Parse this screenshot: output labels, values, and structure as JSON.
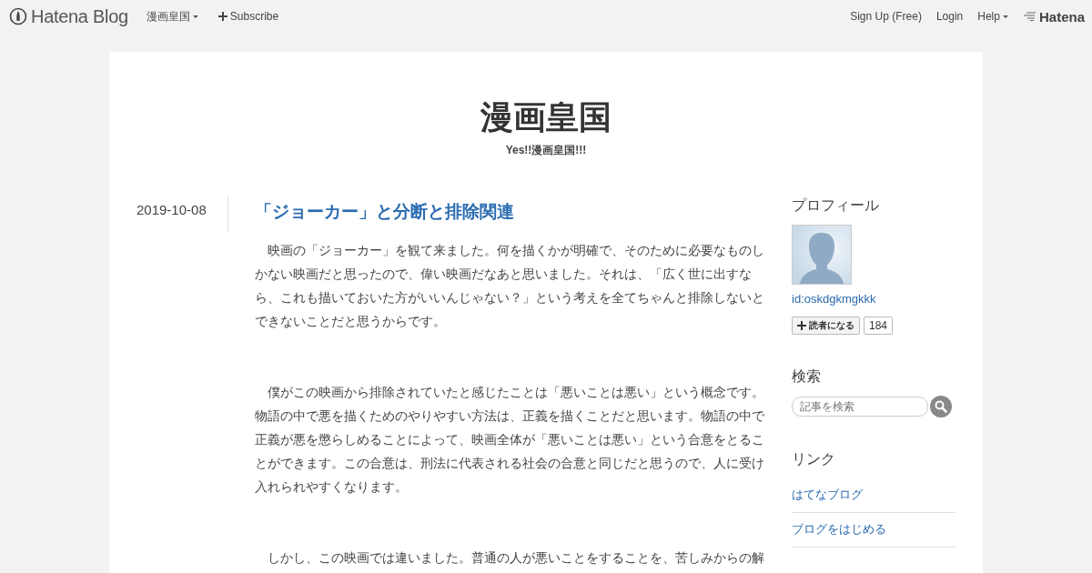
{
  "top_bar": {
    "brand": "Hatena Blog",
    "blog_menu": "漫画皇国",
    "subscribe": "Subscribe",
    "links": [
      {
        "label": "Sign Up (Free)",
        "kind": "link"
      },
      {
        "label": "Login",
        "kind": "link"
      },
      {
        "label": "Help",
        "kind": "menu"
      }
    ],
    "hatena_logo": "Hatena"
  },
  "blog": {
    "title": "漫画皇国",
    "tagline": "Yes!!漫画皇国!!!"
  },
  "entry": {
    "date": "2019-10-08",
    "title": "「ジョーカー」と分断と排除関連",
    "paragraphs": [
      "映画の「ジョーカー」を観て来ました。何を描くかが明確で、そのために必要なものしかない映画だと思ったので、偉い映画だなあと思いました。それは、「広く世に出すなら、これも描いておいた方がいいんじゃない？」という考えを全てちゃんと排除しないとできないことだと思うからです。",
      "僕がこの映画から排除されていたと感じたことは「悪いことは悪い」という概念です。物語の中で悪を描くためのやりやすい方法は、正義を描くことだと思います。物語の中で正義が悪を懲らしめることによって、映画全体が「悪いことは悪い」という合意をとることができます。この合意は、刑法に代表される社会の合意と同じだと思うので、人に受け入れられやすくなります。",
      "しかし、この映画では違いました。普通の人が悪いことをすることを、苦しみからの解"
    ]
  },
  "sidebar": {
    "profile": {
      "heading": "プロフィール",
      "user_id": "id:oskdgkmgkkk",
      "follow_button": "読者になる",
      "follower_count": "184"
    },
    "search": {
      "heading": "検索",
      "placeholder": "記事を検索"
    },
    "links": {
      "heading": "リンク",
      "items": [
        "はてなブログ",
        "ブログをはじめる"
      ]
    }
  }
}
